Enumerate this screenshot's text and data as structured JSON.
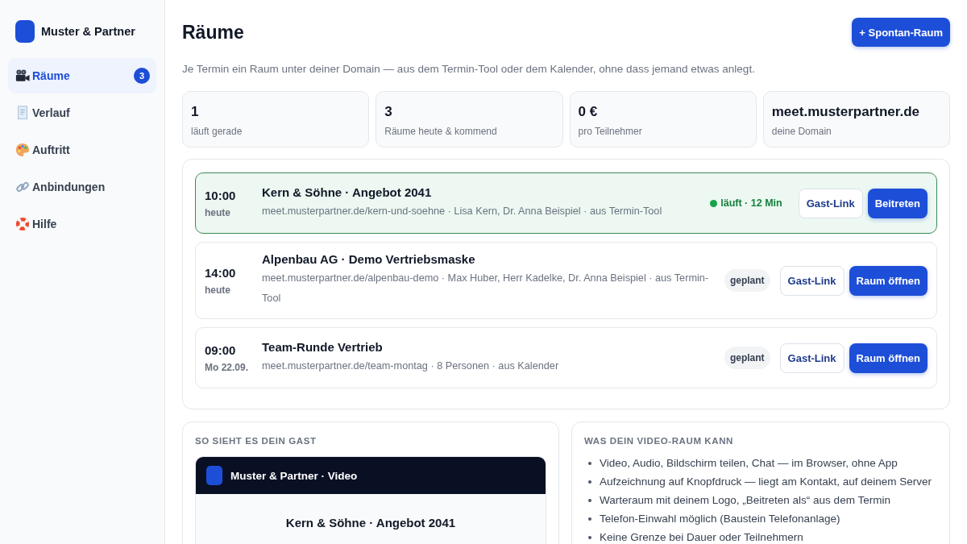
{
  "sidebar": {
    "brand": "Muster & Partner",
    "items": [
      {
        "label": "Räume",
        "selected": true,
        "badge": "3"
      },
      {
        "label": "Verlauf",
        "selected": false
      },
      {
        "label": "Auftritt",
        "selected": false
      },
      {
        "label": "Anbindungen",
        "selected": false
      },
      {
        "label": "Hilfe",
        "selected": false
      }
    ]
  },
  "header": {
    "title": "Räume",
    "action": "+ Spontan-Raum",
    "subtitle": "Je Termin ein Raum unter deiner Domain — aus dem Termin-Tool oder dem Kalender, ohne dass jemand etwas anlegt."
  },
  "stats": [
    {
      "value": "1",
      "label": "läuft gerade"
    },
    {
      "value": "3",
      "label": "Räume heute & kommend"
    },
    {
      "value": "0 €",
      "label": "pro Teilnehmer"
    },
    {
      "value": "meet.musterpartner.de",
      "label": "deine Domain"
    }
  ],
  "rooms": [
    {
      "time": "10:00",
      "day": "heute",
      "title": "Kern & Söhne · Angebot 2041",
      "details": "meet.musterpartner.de/kern-und-soehne · Lisa Kern, Dr. Anna Beispiel · aus Termin-Tool",
      "status": {
        "kind": "live",
        "text": "läuft · 12 Min"
      },
      "guest_button": "Gast-Link",
      "primary_button": "Beitreten"
    },
    {
      "time": "14:00",
      "day": "heute",
      "title": "Alpenbau AG · Demo Vertriebsmaske",
      "details": "meet.musterpartner.de/alpenbau-demo · Max Huber, Herr Kadelke, Dr. Anna Beispiel · aus Termin-Tool",
      "status": {
        "kind": "planned",
        "text": "geplant"
      },
      "guest_button": "Gast-Link",
      "primary_button": "Raum öffnen"
    },
    {
      "time": "09:00",
      "day": "Mo 22.09.",
      "title": "Team-Runde Vertrieb",
      "details": "meet.musterpartner.de/team-montag · 8 Personen · aus Kalender",
      "status": {
        "kind": "planned",
        "text": "geplant"
      },
      "guest_button": "Gast-Link",
      "primary_button": "Raum öffnen"
    }
  ],
  "preview": {
    "heading": "SO SIEHT ES DEIN GAST",
    "window_title": "Muster & Partner · Video",
    "meeting_title": "Kern & Söhne · Angebot 2041"
  },
  "features": {
    "heading": "WAS DEIN VIDEO-RAUM KANN",
    "items": [
      "Video, Audio, Bildschirm teilen, Chat — im Browser, ohne App",
      "Aufzeichnung auf Knopfdruck — liegt am Kontakt, auf deinem Server",
      "Warteraum mit deinem Logo, „Beitreten als“ aus dem Termin",
      "Telefon-Einwahl möglich (Baustein Telefonanlage)",
      "Keine Grenze bei Dauer oder Teilnehmern"
    ]
  }
}
